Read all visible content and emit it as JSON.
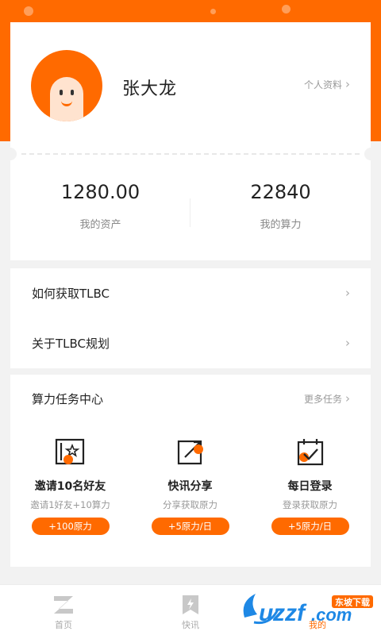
{
  "profile": {
    "name": "张大龙",
    "profile_link": "个人资料"
  },
  "stats": {
    "assets_value": "1280.00",
    "assets_label": "我的资产",
    "power_value": "22840",
    "power_label": "我的算力"
  },
  "links": [
    {
      "label": "如何获取TLBC"
    },
    {
      "label": "关于TLBC规划"
    }
  ],
  "tasks": {
    "title": "算力任务中心",
    "more": "更多任务",
    "items": [
      {
        "icon": "invite-icon",
        "name": "邀请10名好友",
        "desc": "邀请1好友+10算力",
        "button": "+100原力"
      },
      {
        "icon": "share-icon",
        "name": "快讯分享",
        "desc": "分享获取原力",
        "button": "+5原力/日"
      },
      {
        "icon": "calendar-check-icon",
        "name": "每日登录",
        "desc": "登录获取原力",
        "button": "+5原力/日"
      }
    ]
  },
  "tabbar": {
    "items": [
      {
        "label": "首页",
        "icon": "home-logo-icon",
        "active": false
      },
      {
        "label": "快讯",
        "icon": "news-icon",
        "active": false
      },
      {
        "label": "我的",
        "icon": "profile-icon",
        "active": true
      }
    ]
  },
  "watermark": {
    "text": "uzzf.com",
    "badge": "东坡下载"
  },
  "colors": {
    "accent": "#ff6a00",
    "background": "#f2f2f2",
    "card": "#ffffff"
  }
}
